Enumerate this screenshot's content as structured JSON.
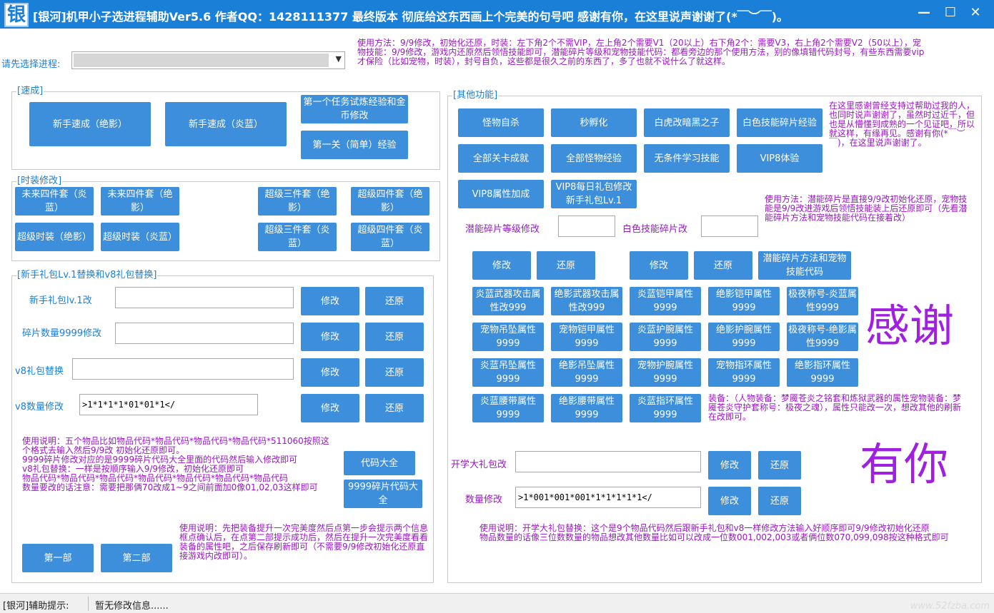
{
  "window": {
    "icon_glyph": "银",
    "title": "[银河]机甲小子选进程辅助Ver5.6   作者QQ：1428111377  最终版本 彻底给这东西画上个完美的句号吧  感谢有你，在这里说声谢谢了(*￣︶￣)。",
    "minimize": "—",
    "maximize": "☐",
    "close": "✕"
  },
  "process": {
    "label": "请先选择进程:",
    "value": ""
  },
  "top_note": "使用方法：9/9修改，初始化还原，时装：左下角2个不需VIP，左上角2个需要V1（20以上）右下角2个：需要V3，右上角2个需要V2（50以上），宠物技能：9/9修改，游戏内还原然后领悟技能即可，潜能碎片等级和宠物技能代码：都看旁边的那个使用方法，别的像填错代码封号，有些东西需要vip才保险（比如宠物，时装），封号自负，这些都是很久之前的东西了，多了也就不说什么了就这样。",
  "speed": {
    "title": "[速成]",
    "btn_jueying": "新手速成（绝影）",
    "btn_yanlan": "新手速成（炎蓝）",
    "btn_first_task": "第一个任务试炼经验和金币修改",
    "btn_level1": "第一关（简单）经验"
  },
  "fashion": {
    "title": "[时装修改]",
    "b1": "未来四件套（炎蓝）",
    "b2": "未来四件套（绝影）",
    "b3": "超级三件套（绝影）",
    "b4": "超级四件套（绝影）",
    "b5": "超级时装（绝影）",
    "b6": "超级时装（炎蓝）",
    "b7": "超级三件套（炎蓝）",
    "b8": "超级四件套（炎蓝）"
  },
  "gift": {
    "title": "[新手礼包Lv.1替换和v8礼包替换]",
    "row1_label": "新手礼包lv.1改",
    "row1_value": "",
    "row2_label": "碎片数量9999修改",
    "row2_value": "",
    "row3_label": "v8礼包替换",
    "row3_value": "",
    "row4_label": "v8数量修改",
    "row4_value": ">1*1*1*1*01*01*1</",
    "modify": "修改",
    "restore": "还原",
    "note": "使用说明：五个物品比如物品代码*物品代码*物品代码*物品代码*511060按照这个格式去输入然后9/9改 初始化还原即可。\n9999碎片修改对应的是9999碎片代码大全里面的代码然后输入修改即可\nv8礼包替换：一样是按顺序输入9/9修改，初始化还原即可\n物品代码*物品代码*物品代码*物品代码*物品代码*物品代码*物品代码\n数量要改的话注意：需要把那俩70改成1~9之间前面加0像01,02,03这样即可",
    "btn_codes": "代码大全",
    "btn_shard_codes": "9999碎片代码大全",
    "btn_part1": "第一部",
    "btn_part2": "第二部",
    "part_note": "使用说明：先把装备提升一次完美度然后点第一步会提示两个信息框点确认后，在点第二部提示成功后，然后在提升一次完美度看看装备的属性吧，之后保存刷新即可（不需要9/9修改初始化还原直接游戏内改即可）。"
  },
  "other": {
    "title": "[其他功能]",
    "b_monster_suicide": "怪物自杀",
    "b_instant_hatch": "秒孵化",
    "b_tiger": "白虎改暗黑之子",
    "b_white_exp": "白色技能碎片经验",
    "b_all_cards": "全部关卡成就",
    "b_all_monster_exp": "全部怪物经验",
    "b_learn_skill": "无条件学习技能",
    "b_vip8": "VIP8体验",
    "b_vip8_attr": "VIP8属性加成",
    "b_vip8_daily": "VIP8每日礼包修改新手礼包Lv.1",
    "thanks_note": "在这里感谢曾经支持过帮助过我的人，也同时说声谢谢了，虽然时过近千，但也是从懵懂到成熟的一个见证吧，所以就这样，有缘再见。感谢有你(*￣︶￣)，在这里说声谢谢了。",
    "potential_label": "潜能碎片等级修改",
    "potential_value": "",
    "white_label": "白色技能碎片改",
    "white_value": "",
    "usage_note": "使用方法：潜能碎片是直接9/9改初始化还原，宠物技能是9/9改进游戏后领悟技能装上后还原即可（先看潜能碎片方法和宠物技能代码在接着改）",
    "modify": "修改",
    "restore": "还原",
    "b_potential_method": "潜能碎片方法和宠物技能代码",
    "grid": [
      "炎蓝武器攻击属性改999",
      "绝影武器攻击属性改999",
      "炎蓝铠甲属性9999",
      "绝影铠甲属性9999",
      "极夜称号-炎蓝属性9999",
      "宠物吊坠属性9999",
      "宠物铠甲属性9999",
      "炎蓝护腕属性9999",
      "绝影护腕属性9999",
      "极夜称号-绝影属性9999",
      "炎蓝吊坠属性9999",
      "绝影吊坠属性9999",
      "宠物护腕属性9999",
      "宠物指环属性9999",
      "绝影指环属性9999",
      "炎蓝腰带属性9999",
      "绝影腰带属性9999",
      "炎蓝指环属性9999"
    ],
    "equip_note": "装备：（人物装备：梦魇苍炎之铭套和炼狱武器的属性宠物装备：梦魇苍炎守护套称号：极夜之魂），属性只能改一次，想改其他的刷新在改即可。",
    "big_thanks": "感谢",
    "big_you": "有你",
    "school_label": "开学大礼包改",
    "school_value": "",
    "count_label": "数量修改",
    "count_value": ">1*001*001*001*1*1*1*1*1</",
    "school_note": "使用说明：开学大礼包替换：这个是9个物品代码然后跟新手礼包和v8一样修改方法输入好顺序即可9/9修改初始化还原\n物品数量的话像三位数数量的物品想改其他数量比如可以改成一位数001,002,003或者俩位数070,099,098按这种格式即可"
  },
  "status": {
    "label": "[银河]辅助提示:",
    "message": "暂无修改信息......",
    "watermark": "www.52fzba.com"
  },
  "colors": {
    "titlebar": "#1a7fd6",
    "button": "#3d8fdb",
    "label_blue": "#1a7fd6",
    "note_purple": "#9b16c7",
    "big_purple": "#a11fe0"
  }
}
